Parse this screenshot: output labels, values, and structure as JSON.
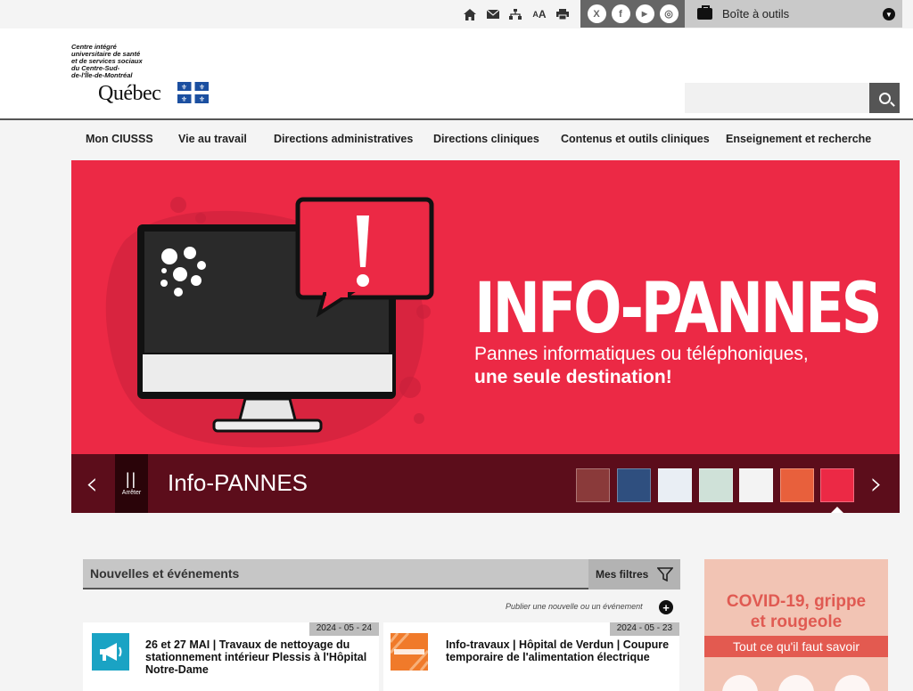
{
  "topbar": {
    "utilities": [
      {
        "name": "home-icon",
        "glyph": "⌂"
      },
      {
        "name": "mail-icon",
        "glyph": "✉"
      },
      {
        "name": "sitemap-icon",
        "glyph": "⊞"
      },
      {
        "name": "text-size-icon",
        "glyph": "AA"
      },
      {
        "name": "print-icon",
        "glyph": "⎙"
      }
    ],
    "social": [
      "X",
      "f",
      "▶",
      "◎"
    ],
    "toolbox_label": "Boîte à outils"
  },
  "header": {
    "logo_lines": [
      "Centre intégré",
      "universitaire de santé",
      "et de services sociaux",
      "du Centre-Sud-",
      "de-l'Île-de-Montréal"
    ],
    "logo_wordmark": "Québec",
    "search_placeholder": ""
  },
  "nav": {
    "items": [
      "Mon CIUSSS",
      "Vie au travail",
      "Directions administratives",
      "Directions cliniques",
      "Contenus et outils cliniques",
      "Enseignement et recherche"
    ]
  },
  "hero": {
    "headline": "INFO-PANNES",
    "subline": "Pannes informatiques ou téléphoniques,",
    "subline_bold": "une seule destination!",
    "slide_title": "Info-PANNES",
    "pause_label": "Arrêter",
    "prev_glyph": "‹",
    "next_glyph": "›",
    "thumb_colors": [
      "#8a3a3a",
      "#2f4f7f",
      "#e9eef4",
      "#cfe1d8",
      "#f3f3f3",
      "#e8603c",
      "#ec2945"
    ]
  },
  "news": {
    "title": "Nouvelles et événements",
    "filters_label": "Mes filtres",
    "publish_label": "Publier une nouvelle ou un événement",
    "cards": [
      {
        "date": "2024 - 05 - 24",
        "text": "26 et 27 MAI | Travaux de nettoyage du stationnement intérieur Plessis à l'Hôpital Notre-Dame",
        "icon": "megaphone-icon",
        "icon_color": "#1aa3c4"
      },
      {
        "date": "2024 - 05 - 23",
        "text": "Info-travaux | Hôpital de Verdun | Coupure temporaire de l'alimentation électrique",
        "icon": "construction-icon",
        "icon_color": "#f07a2a"
      }
    ]
  },
  "covid": {
    "title_line1": "COVID-19, grippe",
    "title_line2": "et rougeole",
    "band": "Tout ce qu'il faut savoir"
  }
}
